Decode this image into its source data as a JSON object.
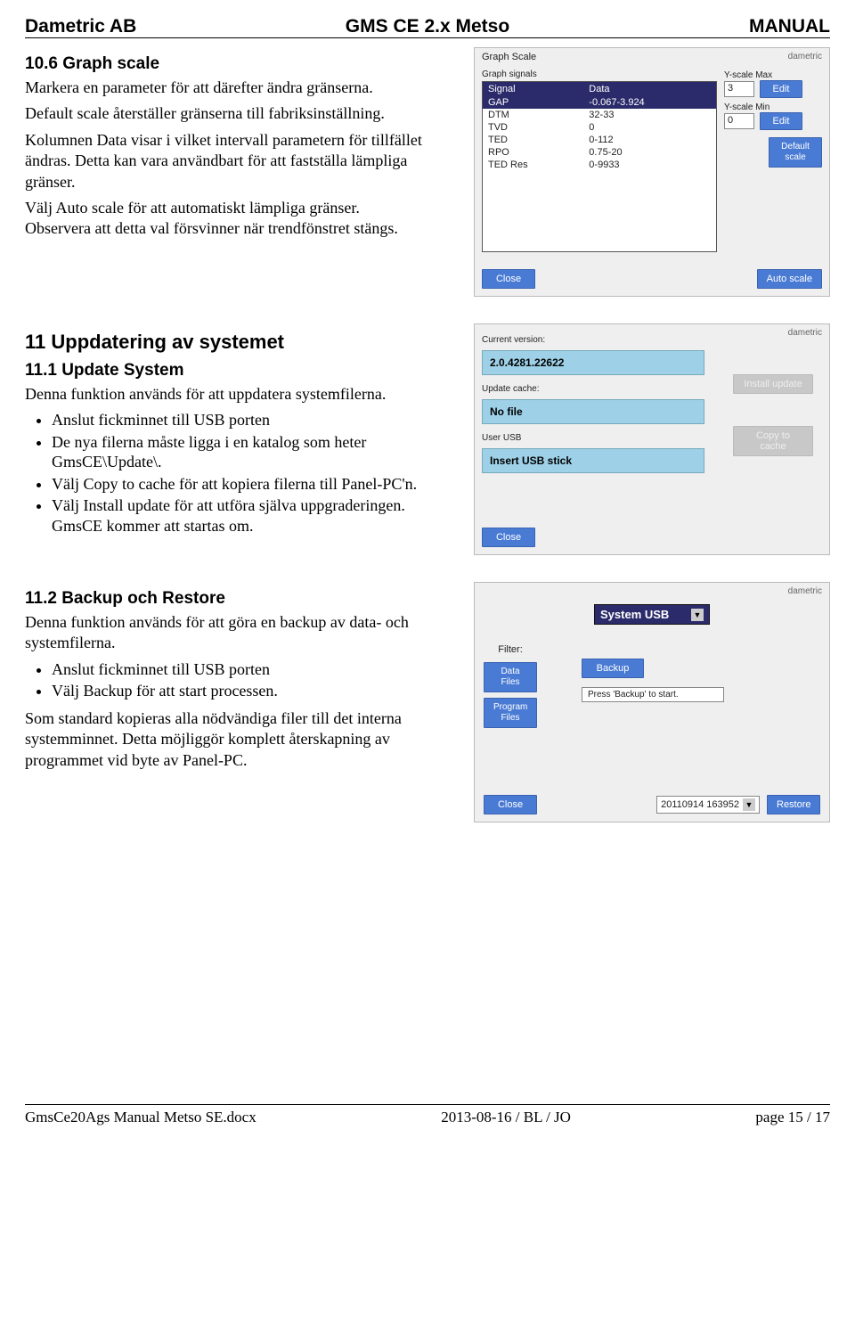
{
  "header": {
    "left": "Dametric AB",
    "center": "GMS CE 2.x Metso",
    "right": "MANUAL"
  },
  "s106": {
    "title": "10.6  Graph scale",
    "p1": "Markera en parameter för att därefter ändra gränserna.",
    "p2": "Default scale återställer gränserna till fabriksinställning.",
    "p3": "Kolumnen Data visar i vilket intervall parametern för tillfället ändras. Detta kan vara användbart för att fastställa lämpliga gränser.",
    "p4": "Välj Auto scale för att automatiskt lämpliga gränser. Observera att detta val försvinner när trendfönstret stängs."
  },
  "panel1": {
    "title": "Graph Scale",
    "brand": "dametric",
    "section": "Graph signals",
    "col1": "Signal",
    "col2": "Data",
    "rows": [
      {
        "sig": "GAP",
        "data": "-0.067-3.924",
        "sel": true
      },
      {
        "sig": "DTM",
        "data": "32-33"
      },
      {
        "sig": "TVD",
        "data": "0"
      },
      {
        "sig": "TED",
        "data": "0-112"
      },
      {
        "sig": "RPO",
        "data": "0.75-20"
      },
      {
        "sig": "TED Res",
        "data": "0-9933"
      }
    ],
    "ymax_label": "Y-scale Max",
    "ymax_value": "3",
    "ymin_label": "Y-scale Min",
    "ymin_value": "0",
    "edit": "Edit",
    "default_scale": "Default scale",
    "close": "Close",
    "auto_scale": "Auto scale"
  },
  "s11": {
    "title": "11  Uppdatering av systemet"
  },
  "s111": {
    "title": "11.1  Update System",
    "p1": "Denna funktion används för att uppdatera systemfilerna.",
    "b1": "Anslut fickminnet till USB porten",
    "b2": "De nya filerna måste ligga i en katalog som heter GmsCE\\Update\\.",
    "b3": "Välj Copy to cache för att kopiera filerna till Panel-PC'n.",
    "b4": "Välj Install update för att utföra själva uppgraderingen. GmsCE kommer att startas om."
  },
  "panel2": {
    "brand": "dametric",
    "cur_label": "Current version:",
    "cur_value": "2.0.4281.22622",
    "cache_label": "Update cache:",
    "cache_value": "No file",
    "usb_label": "User USB",
    "usb_value": "Insert USB stick",
    "install": "Install update",
    "copy": "Copy to cache",
    "close": "Close"
  },
  "s112": {
    "title": "11.2  Backup och Restore",
    "p1": "Denna funktion används för att göra en backup av data- och systemfilerna.",
    "b1": "Anslut fickminnet till USB porten",
    "b2": "Välj Backup för att start processen.",
    "p2": "Som standard kopieras alla nödvändiga filer till det interna systemminnet. Detta möjliggör komplett återskapning av programmet vid byte av Panel-PC."
  },
  "panel3": {
    "brand": "dametric",
    "target": "System USB",
    "filter_label": "Filter:",
    "data_files": "Data Files",
    "program_files": "Program Files",
    "backup": "Backup",
    "restore": "Restore",
    "status": "Press 'Backup' to start.",
    "timestamp": "20110914 163952",
    "close": "Close"
  },
  "footer": {
    "left": "GmsCe20Ags Manual Metso SE.docx",
    "center": "2013-08-16 / BL / JO",
    "right": "page 15 / 17"
  }
}
